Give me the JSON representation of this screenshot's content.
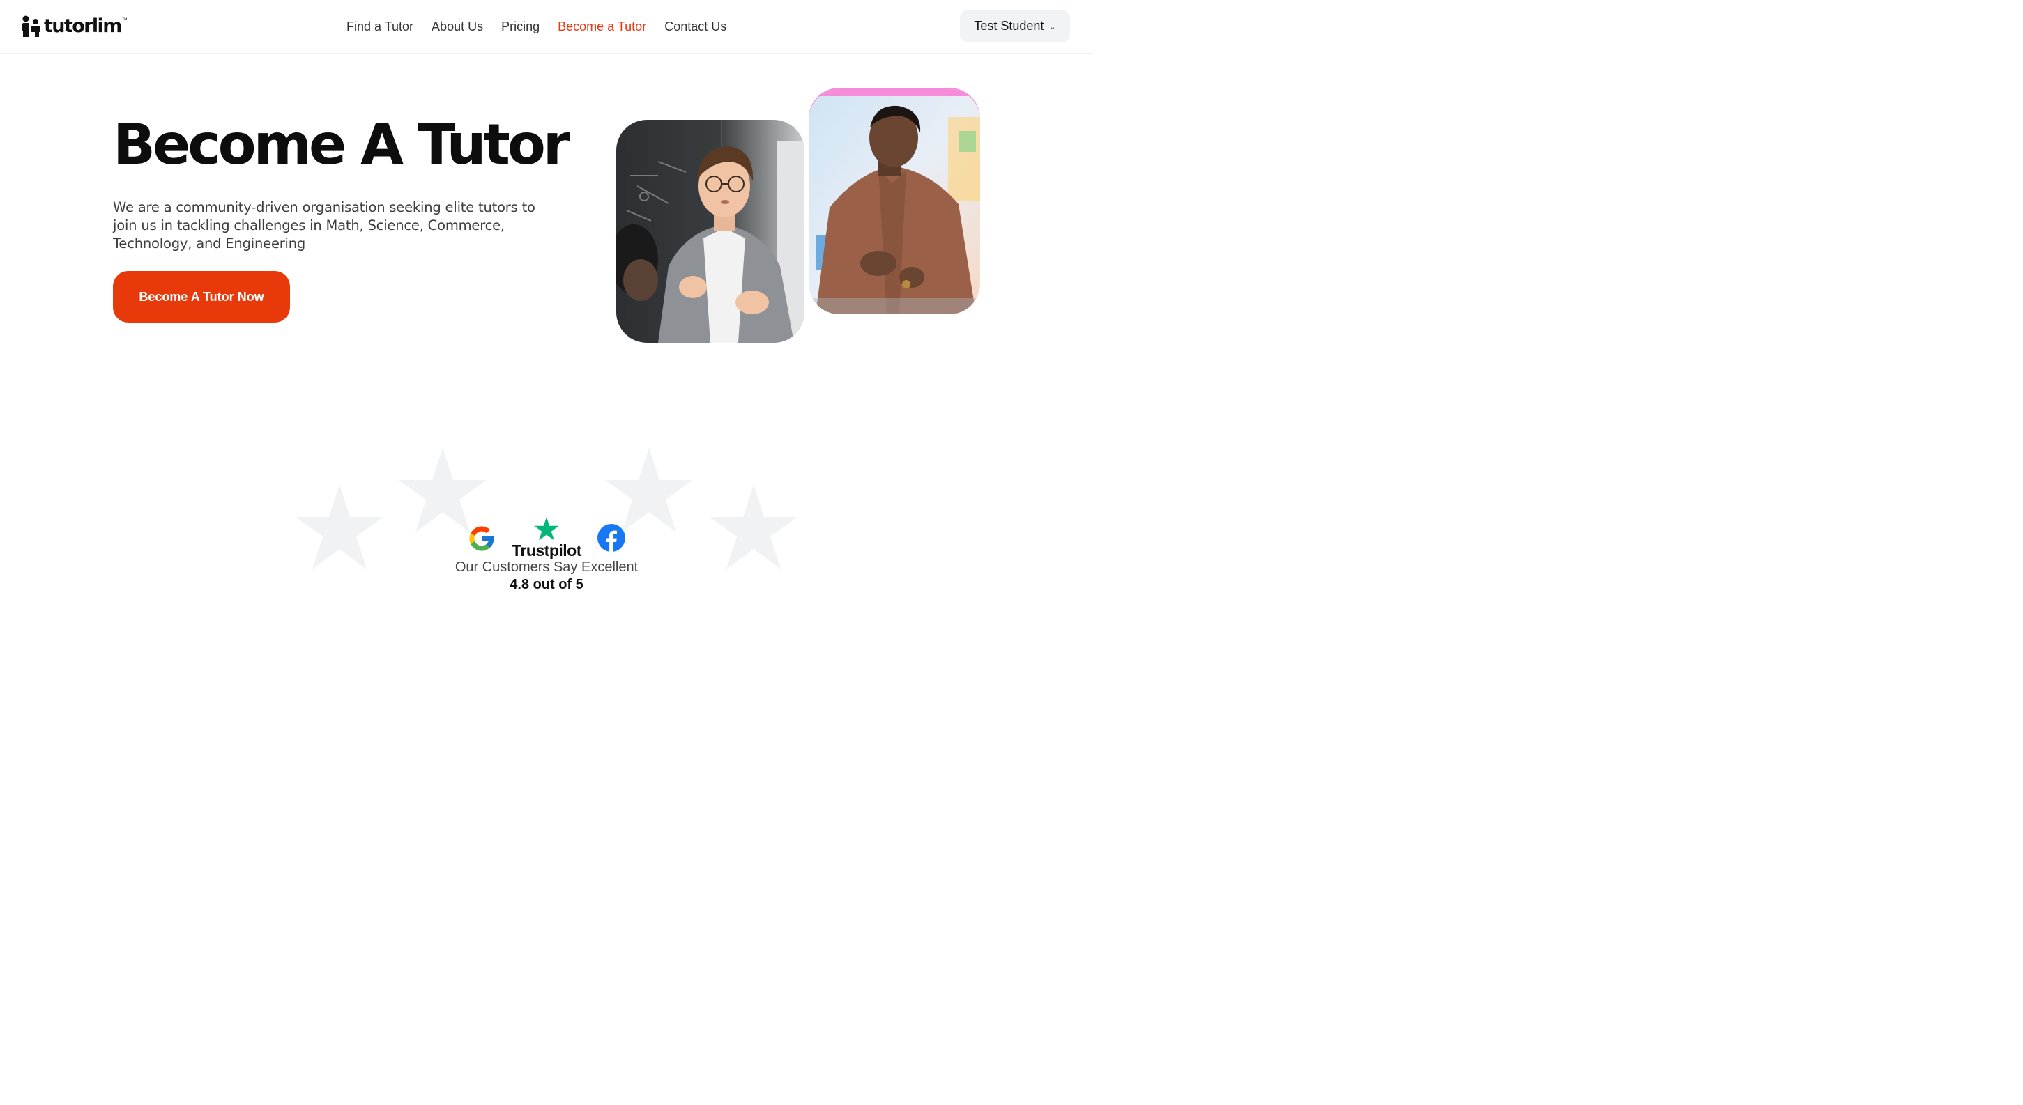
{
  "brand": {
    "name": "tutorlim",
    "trademark": "™"
  },
  "nav": {
    "items": [
      {
        "label": "Find a Tutor",
        "active": false
      },
      {
        "label": "About Us",
        "active": false
      },
      {
        "label": "Pricing",
        "active": false
      },
      {
        "label": "Become a Tutor",
        "active": true
      },
      {
        "label": "Contact Us",
        "active": false
      }
    ]
  },
  "user_menu": {
    "label": "Test Student",
    "icon": "chevron-down-icon"
  },
  "hero": {
    "title": "Become A Tutor",
    "description": "We are a community-driven organisation seeking elite tutors to join us in tackling challenges in Math, Science, Commerce, Technology, and Engineering",
    "cta_label": "Become A Tutor Now"
  },
  "reviews": {
    "platforms": [
      "google-icon",
      "trustpilot-icon",
      "facebook-icon"
    ],
    "trustpilot_label": "Trustpilot",
    "caption": "Our Customers Say Excellent",
    "score": "4.8 out of 5"
  },
  "colors": {
    "accent": "#e8390b",
    "nav_active": "#e53a12",
    "trustpilot_green": "#00b67a",
    "facebook_blue": "#1877f2",
    "star_bg": "#f1f2f4"
  }
}
